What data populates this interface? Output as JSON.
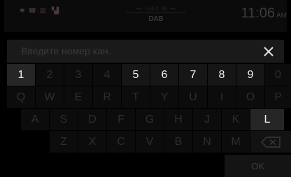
{
  "status": {
    "source_top": "—  ·ıı/ı/  ½  —",
    "source": "DAB",
    "time": "11:06",
    "ampm": "AM"
  },
  "input": {
    "placeholder": "Введите номер кан."
  },
  "keyboard": {
    "row1": [
      "1",
      "2",
      "3",
      "4",
      "5",
      "6",
      "7",
      "8",
      "9",
      "0"
    ],
    "row2": [
      "Q",
      "W",
      "E",
      "R",
      "T",
      "Y",
      "U",
      "I",
      "O",
      "P"
    ],
    "row3": [
      "A",
      "S",
      "D",
      "F",
      "G",
      "H",
      "J",
      "K",
      "L"
    ],
    "row4": [
      "Z",
      "X",
      "C",
      "V",
      "B",
      "N",
      "M"
    ],
    "ok_label": "OK"
  },
  "colors": {
    "active_text": "#f2f2f2",
    "inactive_text": "#2e2e2e"
  }
}
